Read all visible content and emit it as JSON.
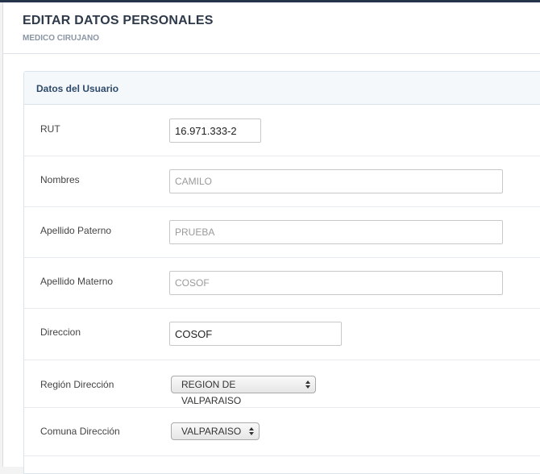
{
  "header": {
    "title": "EDITAR DATOS PERSONALES",
    "subtitle": "MEDICO CIRUJANO"
  },
  "panel": {
    "title": "Datos del Usuario"
  },
  "form": {
    "rut": {
      "label": "RUT",
      "value": "16.971.333-2"
    },
    "nombres": {
      "label": "Nombres",
      "value": "CAMILO"
    },
    "apellido_paterno": {
      "label": "Apellido Paterno",
      "value": "PRUEBA"
    },
    "apellido_materno": {
      "label": "Apellido Materno",
      "value": "COSOF"
    },
    "direccion": {
      "label": "Direccion",
      "value": "COSOF"
    },
    "region": {
      "label": "Región Dirección",
      "selected": "REGION DE VALPARAISO"
    },
    "comuna": {
      "label": "Comuna Dirección",
      "selected": "VALPARAISO"
    }
  },
  "colors": {
    "top_bar": "#26344b",
    "title": "#2e3a4a",
    "panel_title": "#2e4a6a"
  }
}
